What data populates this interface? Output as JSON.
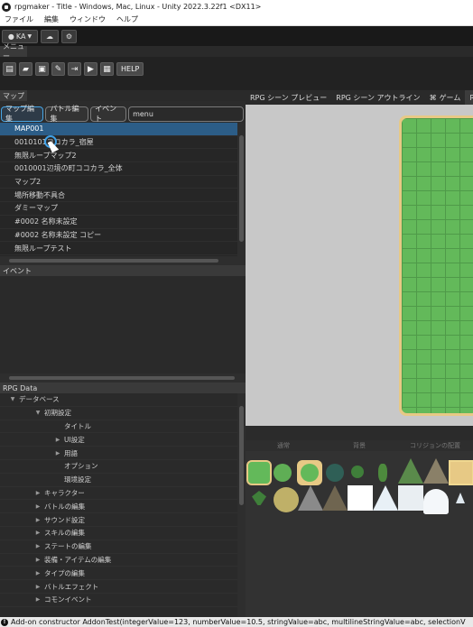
{
  "window": {
    "title": "rpgmaker - Title - Windows, Mac, Linux - Unity 2022.3.22f1 <DX11>"
  },
  "menubar": {
    "items": [
      "ファイル",
      "編集",
      "ウィンドウ",
      "ヘルプ"
    ]
  },
  "unity_toolbar": {
    "account": "KA"
  },
  "menu_panel": {
    "tab": "メニュー",
    "help_label": "HELP"
  },
  "map_panel": {
    "tab": "マップ",
    "tabs": [
      "マップ編集",
      "バトル編集",
      "イベント",
      "menu"
    ],
    "items": [
      "MAP001",
      "0010101ココカラ_宿屋",
      "無限ループマップ2",
      "0010001辺境の町ココカラ_全体",
      "マップ2",
      "場所移動不具合",
      "ダミーマップ",
      "#0002 名称未設定",
      "#0002 名称未設定 コピー",
      "無限ループテスト"
    ]
  },
  "event_panel": {
    "tab": "イベント"
  },
  "rpg_data": {
    "tab": "RPG Data",
    "tree": [
      {
        "label": "データベース",
        "level": 1,
        "arrow": "down"
      },
      {
        "label": "初期設定",
        "level": 2,
        "arrow": "down"
      },
      {
        "label": "タイトル",
        "level": 3,
        "arrow": ""
      },
      {
        "label": "UI設定",
        "level": 3,
        "arrow": "right"
      },
      {
        "label": "用語",
        "level": 3,
        "arrow": "right"
      },
      {
        "label": "オプション",
        "level": 3,
        "arrow": ""
      },
      {
        "label": "環境設定",
        "level": 3,
        "arrow": ""
      },
      {
        "label": "キャラクター",
        "level": 2,
        "arrow": "right"
      },
      {
        "label": "バトルの編集",
        "level": 2,
        "arrow": "right"
      },
      {
        "label": "サウンド設定",
        "level": 2,
        "arrow": "right"
      },
      {
        "label": "スキルの編集",
        "level": 2,
        "arrow": "right"
      },
      {
        "label": "ステートの編集",
        "level": 2,
        "arrow": "right"
      },
      {
        "label": "装備・アイテムの編集",
        "level": 2,
        "arrow": "right"
      },
      {
        "label": "タイプの編集",
        "level": 2,
        "arrow": "right"
      },
      {
        "label": "バトルエフェクト",
        "level": 2,
        "arrow": "right"
      },
      {
        "label": "コモンイベント",
        "level": 2,
        "arrow": "right"
      }
    ]
  },
  "scene_tabs": [
    "RPG シーン プレビュー",
    "RPG シーン アウトライン",
    "ゲーム",
    "RPG"
  ],
  "palette_tabs": [
    "通常",
    "背景",
    "コリジョンの配置"
  ],
  "status_bar": {
    "text": "Add-on constructor AddonTest(integerValue=123, numberValue=10.5, stringValue=abc, multilineStringValue=abc, selectionV"
  }
}
